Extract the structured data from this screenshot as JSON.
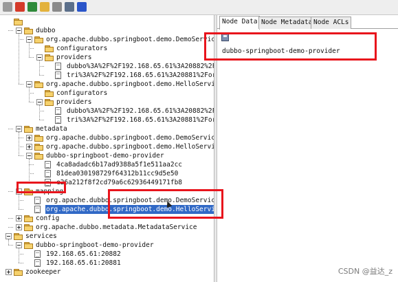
{
  "toolbar": {
    "buttons": [
      {
        "icon": "connect-icon",
        "color": "#9a9a9a"
      },
      {
        "icon": "disconnect-icon",
        "color": "#d43a2a"
      },
      {
        "icon": "refresh-icon",
        "color": "#2f8a3a"
      },
      {
        "icon": "add-node-icon",
        "color": "#e3b23c"
      },
      {
        "icon": "delete-node-icon",
        "color": "#8a8a8a"
      },
      {
        "icon": "settings-icon",
        "color": "#5b6f8a"
      },
      {
        "icon": "info-icon",
        "color": "#2a55c9"
      }
    ]
  },
  "tree": {
    "nodes": [
      {
        "id": "root",
        "label": "",
        "depth": 0,
        "type": "folder",
        "expander": "none",
        "selected": false
      },
      {
        "id": "dubbo",
        "label": "dubbo",
        "depth": 1,
        "type": "folder",
        "expander": "minus",
        "selected": false
      },
      {
        "id": "demo-service",
        "label": "org.apache.dubbo.springboot.demo.DemoService",
        "depth": 2,
        "type": "folder",
        "expander": "minus",
        "selected": false
      },
      {
        "id": "demo-configurators",
        "label": "configurators",
        "depth": 3,
        "type": "folder",
        "expander": "none",
        "selected": false
      },
      {
        "id": "demo-providers",
        "label": "providers",
        "depth": 3,
        "type": "folder",
        "expander": "minus",
        "selected": false
      },
      {
        "id": "demo-provider-1",
        "label": "dubbo%3A%2F%2F192.168.65.61%3A20882%2Forg.ap",
        "depth": 4,
        "type": "doc",
        "expander": "none",
        "selected": false
      },
      {
        "id": "demo-provider-2",
        "label": "tri%3A%2F%2F192.168.65.61%3A20881%2Forg.apac",
        "depth": 4,
        "type": "doc",
        "expander": "none",
        "selected": false
      },
      {
        "id": "hello-service",
        "label": "org.apache.dubbo.springboot.demo.HelloService",
        "depth": 2,
        "type": "folder",
        "expander": "minus",
        "selected": false
      },
      {
        "id": "hello-configurators",
        "label": "configurators",
        "depth": 3,
        "type": "folder",
        "expander": "none",
        "selected": false
      },
      {
        "id": "hello-providers",
        "label": "providers",
        "depth": 3,
        "type": "folder",
        "expander": "minus",
        "selected": false
      },
      {
        "id": "hello-provider-1",
        "label": "dubbo%3A%2F%2F192.168.65.61%3A20882%2Forg.ap",
        "depth": 4,
        "type": "doc",
        "expander": "none",
        "selected": false
      },
      {
        "id": "hello-provider-2",
        "label": "tri%3A%2F%2F192.168.65.61%3A20881%2Forg.apac",
        "depth": 4,
        "type": "doc",
        "expander": "none",
        "selected": false
      },
      {
        "id": "metadata",
        "label": "metadata",
        "depth": 1,
        "type": "folder",
        "expander": "minus",
        "selected": false
      },
      {
        "id": "meta-demo-service",
        "label": "org.apache.dubbo.springboot.demo.DemoService",
        "depth": 2,
        "type": "folder",
        "expander": "plus",
        "selected": false
      },
      {
        "id": "meta-hello-service",
        "label": "org.apache.dubbo.springboot.demo.HelloService",
        "depth": 2,
        "type": "folder",
        "expander": "plus",
        "selected": false
      },
      {
        "id": "meta-provider-app",
        "label": "dubbo-springboot-demo-provider",
        "depth": 2,
        "type": "folder",
        "expander": "minus",
        "selected": false
      },
      {
        "id": "meta-rev-1",
        "label": "4ca8adadc6b17ad9388a5f1e511aa2cc",
        "depth": 3,
        "type": "doc",
        "expander": "none",
        "selected": false
      },
      {
        "id": "meta-rev-2",
        "label": "81dea030198729f64312b11cc9d5e50",
        "depth": 3,
        "type": "doc",
        "expander": "none",
        "selected": false
      },
      {
        "id": "meta-rev-3",
        "label": "e26a212f8f2cd79a6c62936449171fb8",
        "depth": 3,
        "type": "doc",
        "expander": "none",
        "selected": false
      },
      {
        "id": "mapping",
        "label": "mapping",
        "depth": 1,
        "type": "folder",
        "expander": "minus",
        "selected": false
      },
      {
        "id": "mapping-demo-service",
        "label": "org.apache.dubbo.springboot.demo.DemoService",
        "depth": 2,
        "type": "doc",
        "expander": "none",
        "selected": false
      },
      {
        "id": "mapping-hello-service",
        "label": "org.apache.dubbo.springboot.demo.HelloService",
        "depth": 2,
        "type": "doc",
        "expander": "none",
        "selected": true
      },
      {
        "id": "config",
        "label": "config",
        "depth": 1,
        "type": "folder",
        "expander": "plus",
        "selected": false
      },
      {
        "id": "metadata-service",
        "label": "org.apache.dubbo.metadata.MetadataService",
        "depth": 1,
        "type": "folder",
        "expander": "plus",
        "selected": false
      },
      {
        "id": "services",
        "label": "services",
        "depth": 0,
        "type": "folder",
        "expander": "minus",
        "selected": false
      },
      {
        "id": "services-provider-app",
        "label": "dubbo-springboot-demo-provider",
        "depth": 1,
        "type": "folder",
        "expander": "minus",
        "selected": false
      },
      {
        "id": "instance-1",
        "label": "192.168.65.61:20882",
        "depth": 2,
        "type": "doc",
        "expander": "none",
        "selected": false
      },
      {
        "id": "instance-2",
        "label": "192.168.65.61:20881",
        "depth": 2,
        "type": "doc",
        "expander": "none",
        "selected": false
      },
      {
        "id": "zookeeper",
        "label": "zookeeper",
        "depth": 0,
        "type": "folder",
        "expander": "plus",
        "selected": false
      }
    ]
  },
  "detail": {
    "tabs": [
      {
        "label": "Node Data",
        "active": true
      },
      {
        "label": "Node Metadata",
        "active": false
      },
      {
        "label": "Node ACLs",
        "active": false
      }
    ],
    "save_icon": "save-icon",
    "node_data": "dubbo-springboot-demo-provider"
  },
  "annotations": {
    "highlight_color": "#e8141c"
  },
  "watermark": "CSDN @益达_z"
}
